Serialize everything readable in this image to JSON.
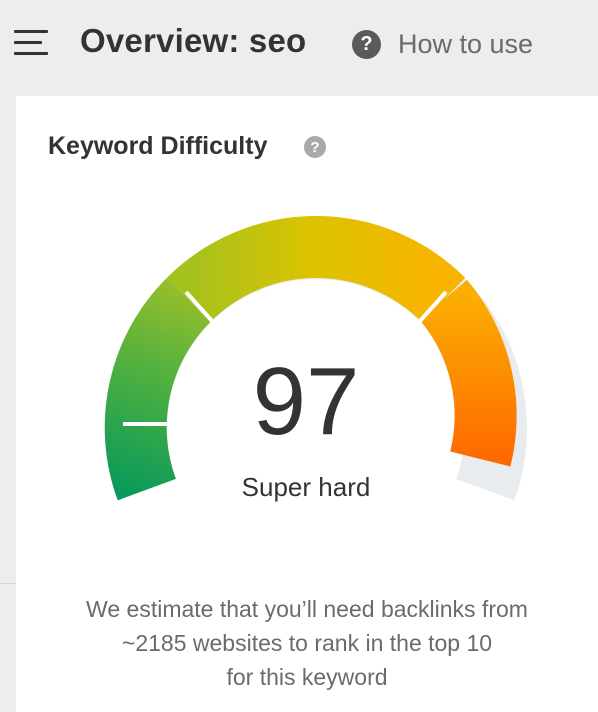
{
  "header": {
    "menu_icon": "hamburger-menu-icon",
    "title": "Overview: seo",
    "help_icon": "question-circle-icon",
    "help_label": "How to use"
  },
  "card": {
    "title": "Keyword Difficulty",
    "info_icon": "question-circle-icon",
    "score": "97",
    "score_max": 100,
    "difficulty_label": "Super hard",
    "estimate_lines": [
      "We estimate that you’ll need backlinks from",
      "~2185 websites to rank in the top 10",
      "for this keyword"
    ]
  },
  "colors": {
    "text": "#333333",
    "muted_text": "#6b6b6b",
    "track": "#e9ecee",
    "gauge_green": "#0f9b58",
    "gauge_yellow": "#d5c400",
    "gauge_orange": "#f7b500",
    "gauge_red": "#ff6a00"
  }
}
